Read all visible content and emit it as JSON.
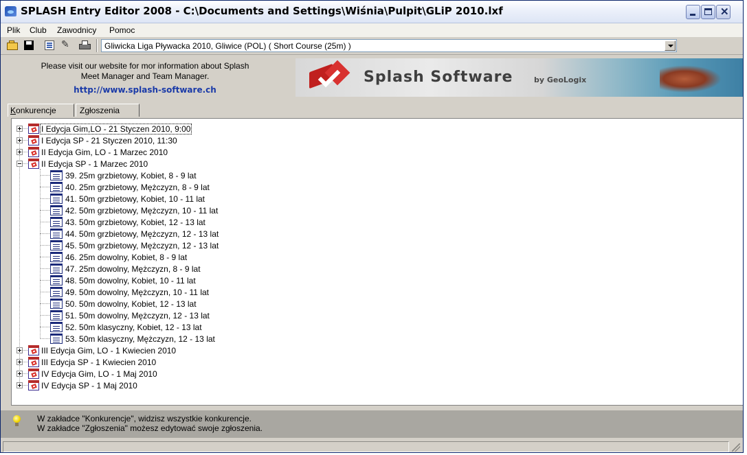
{
  "window": {
    "title": "SPLASH Entry Editor 2008 - C:\\Documents and Settings\\Wiśnia\\Pulpit\\GLiP 2010.lxf",
    "minimize_label": "",
    "maximize_label": "",
    "close_glyph": "✕"
  },
  "menu": [
    "Plik",
    "Club",
    "Zawodnicy",
    "Pomoc"
  ],
  "toolbar": {
    "icons": [
      "open-folder-icon",
      "save-disk-icon",
      "properties-icon",
      "tools-icon",
      "printer-icon"
    ],
    "meet_select_value": "Gliwicka Liga Pływacka 2010,  Gliwice  (POL)  ( Short Course (25m) )"
  },
  "banner": {
    "line1": "Please visit our website for mor information about Splash",
    "line2": "Meet Manager and Team Manager.",
    "link": "http://www.splash-software.ch",
    "brand": "Splash Software",
    "brand_sub": "by GeoLogix"
  },
  "tabs": [
    {
      "label_first": "K",
      "label_rest": "onkurencje",
      "active": true
    },
    {
      "label_first": "",
      "label_rest": "Zgłoszenia",
      "active": false
    }
  ],
  "tree": {
    "sessions_before": [
      {
        "label": "I Edycja Gim,LO - 21 Styczen 2010, 9:00",
        "expanded": false,
        "selected": true
      },
      {
        "label": "I Edycja SP - 21 Styczen 2010, 11:30",
        "expanded": false,
        "selected": false
      },
      {
        "label": "II Edycja Gim, LO - 1 Marzec 2010",
        "expanded": false,
        "selected": false
      },
      {
        "label": "II Edycja SP - 1 Marzec 2010",
        "expanded": true,
        "selected": false
      }
    ],
    "events": [
      "39. 25m grzbietowy, Kobiet,  8 - 9 lat",
      "40. 25m grzbietowy, Mężczyzn,  8 - 9 lat",
      "41. 50m grzbietowy, Kobiet,  10 - 11 lat",
      "42. 50m grzbietowy, Mężczyzn,  10 - 11 lat",
      "43. 50m grzbietowy, Kobiet,  12 - 13 lat",
      "44. 50m grzbietowy, Mężczyzn,  12 - 13 lat",
      "45. 50m grzbietowy, Mężczyzn,  12 - 13 lat",
      "46. 25m dowolny, Kobiet,  8 - 9 lat",
      "47. 25m dowolny, Mężczyzn,  8 - 9 lat",
      "48. 50m dowolny, Kobiet,  10 - 11 lat",
      "49. 50m dowolny, Mężczyzn,  10 - 11 lat",
      "50. 50m dowolny, Kobiet,  12 - 13 lat",
      "51. 50m dowolny, Mężczyzn,  12 - 13 lat",
      "52. 50m klasyczny, Kobiet,  12 - 13 lat",
      "53. 50m klasyczny, Mężczyzn,  12 - 13 lat"
    ],
    "sessions_after": [
      {
        "label": "III Edycja Gim, LO - 1 Kwiecien 2010",
        "expanded": false
      },
      {
        "label": "III Edycja SP - 1 Kwiecien 2010",
        "expanded": false
      },
      {
        "label": "IV Edycja Gim, LO - 1 Maj 2010",
        "expanded": false
      },
      {
        "label": "IV Edycja SP - 1 Maj 2010",
        "expanded": false
      }
    ]
  },
  "hint": {
    "line1": "W zakładce \"Konkurencje\", widzisz wszystkie konkurencje.",
    "line2": "W zakładce \"Zgłoszenia\" możesz edytować swoje zgłoszenia."
  }
}
